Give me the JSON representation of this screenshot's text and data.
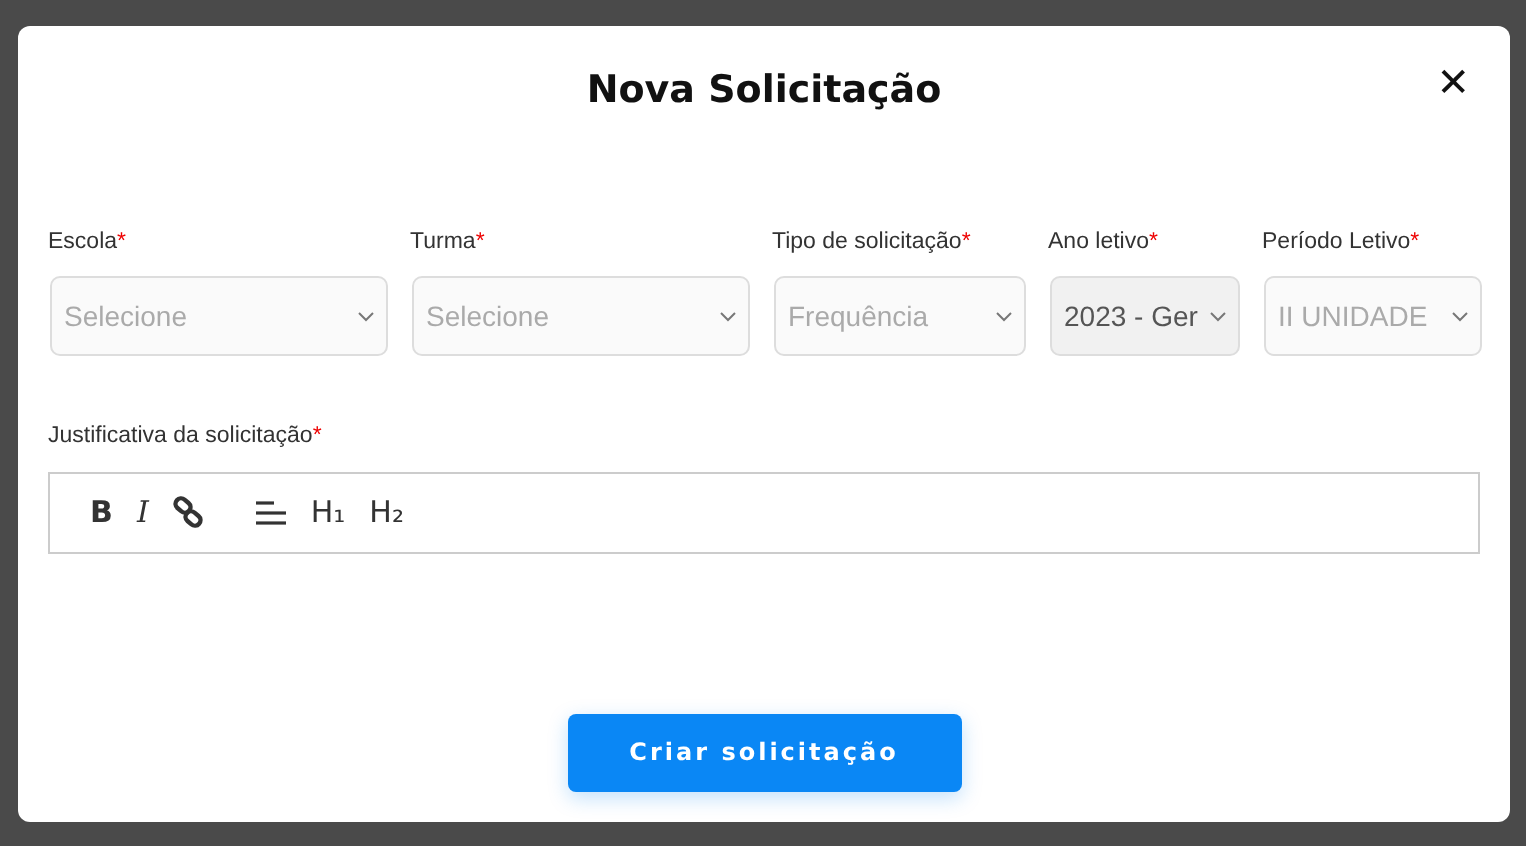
{
  "dialog": {
    "title": "Nova Solicitação",
    "close": "✕"
  },
  "fields": [
    {
      "label": "Escola",
      "required_mark": "*",
      "value": "Selecione",
      "disabled": false
    },
    {
      "label": "Turma",
      "required_mark": "*",
      "value": "Selecione",
      "disabled": false
    },
    {
      "label": "Tipo de solicitação",
      "required_mark": "*",
      "value": "Frequência",
      "disabled": false
    },
    {
      "label": "Ano letivo",
      "required_mark": "*",
      "value": "2023 - Ger",
      "disabled": true
    },
    {
      "label": "Período Letivo",
      "required_mark": "*",
      "value": "II UNIDADE",
      "disabled": false
    }
  ],
  "editor": {
    "label": "Justificativa da solicitação",
    "required_mark": "*",
    "toolbar": [
      {
        "kind": "bold",
        "label": "B"
      },
      {
        "kind": "italic",
        "label": "I"
      },
      {
        "kind": "link"
      },
      {
        "kind": "align"
      },
      {
        "kind": "heading",
        "label": "H₁"
      },
      {
        "kind": "heading",
        "label": "H₂"
      }
    ]
  },
  "submit": "Criar solicitação"
}
